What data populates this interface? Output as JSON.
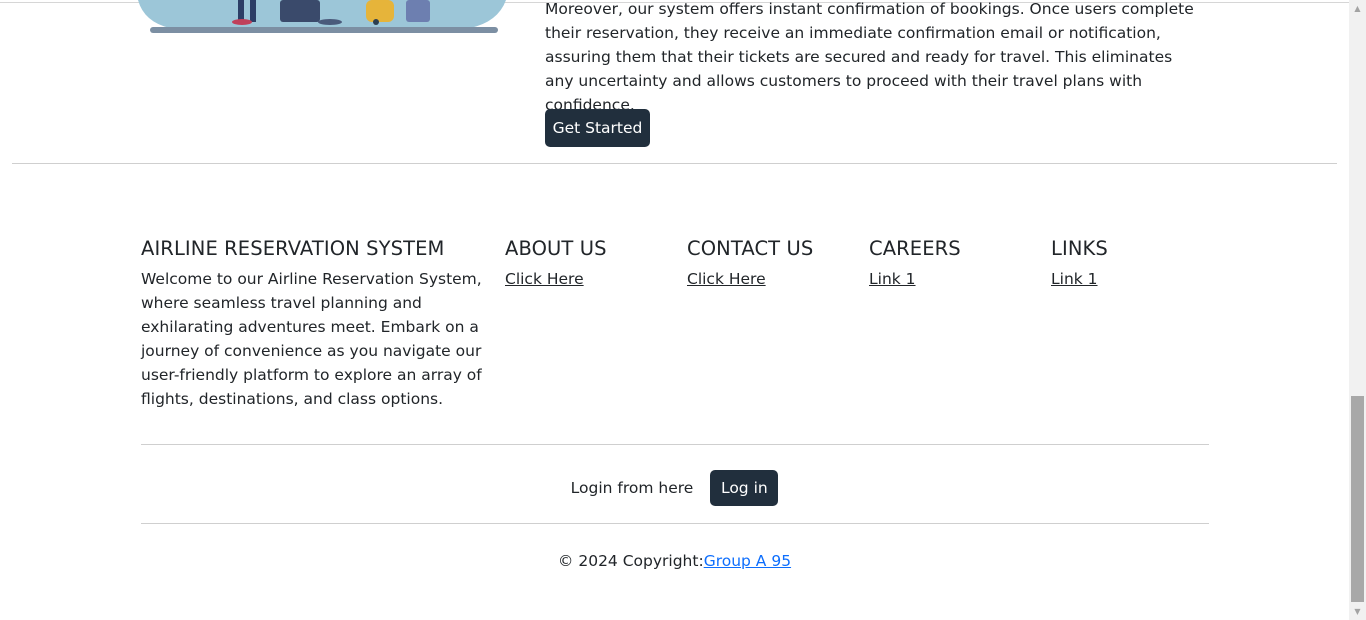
{
  "about": {
    "paragraph": "Moreover, our system offers instant confirmation of bookings. Once users complete their reservation, they receive an immediate confirmation email or notification, assuring them that their tickets are secured and ready for travel. This eliminates any uncertainty and allows customers to proceed with their travel plans with confidence.",
    "cta_label": "Get Started"
  },
  "footer": {
    "brand": {
      "heading": "AIRLINE RESERVATION SYSTEM",
      "text": "Welcome to our Airline Reservation System, where seamless travel planning and exhilarating adventures meet. Embark on a journey of convenience as you navigate our user-friendly platform to explore an array of flights, destinations, and class options."
    },
    "columns": [
      {
        "heading": "ABOUT US",
        "link": "Click Here"
      },
      {
        "heading": "CONTACT US",
        "link": "Click Here"
      },
      {
        "heading": "CAREERS",
        "link": "Link 1"
      },
      {
        "heading": "LINKS",
        "link": "Link 1"
      }
    ],
    "login": {
      "prompt": "Login from here",
      "button": "Log in"
    },
    "copyright": {
      "prefix": "© 2024 Copyright:",
      "link": "Group A 95"
    }
  },
  "colors": {
    "button_bg": "#212f3d",
    "link_blue": "#0d6efd",
    "text": "#212529"
  },
  "icons": {
    "scroll_up": "scroll-up-arrow-icon",
    "scroll_down": "scroll-down-arrow-icon",
    "illustration": "travelers-illustration"
  }
}
